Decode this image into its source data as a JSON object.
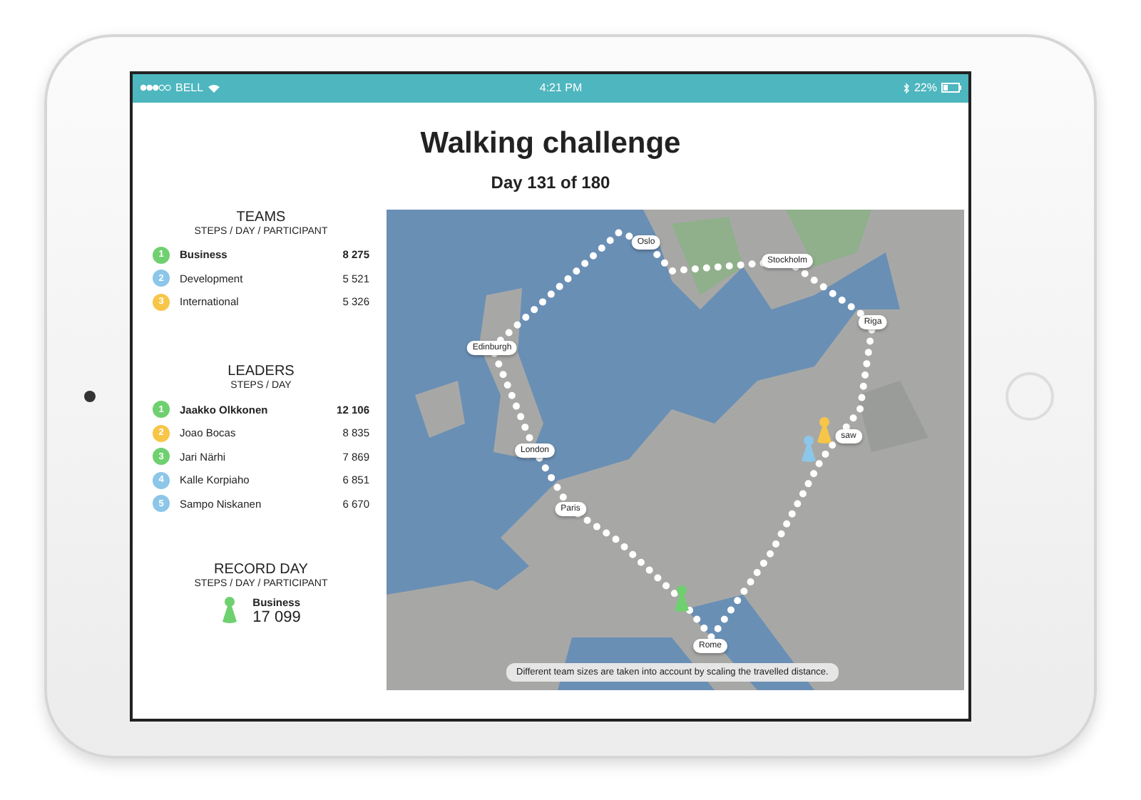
{
  "status_bar": {
    "carrier": "BELL",
    "time": "4:21 PM",
    "battery": "22%"
  },
  "title": "Walking challenge",
  "subtitle": "Day 131 of 180",
  "teams": {
    "title": "TEAMS",
    "subtitle": "STEPS / DAY / PARTICIPANT",
    "rows": [
      {
        "rank": "1",
        "name": "Business",
        "value": "8 275",
        "color": "#6fd06f",
        "highlighted": true
      },
      {
        "rank": "2",
        "name": "Development",
        "value": "5 521",
        "color": "#8cc6e8",
        "highlighted": false
      },
      {
        "rank": "3",
        "name": "International",
        "value": "5 326",
        "color": "#f7c548",
        "highlighted": false
      }
    ]
  },
  "leaders": {
    "title": "LEADERS",
    "subtitle": "STEPS / DAY",
    "rows": [
      {
        "rank": "1",
        "name": "Jaakko Olkkonen",
        "value": "12 106",
        "color": "#6fd06f",
        "highlighted": true
      },
      {
        "rank": "2",
        "name": "Joao Bocas",
        "value": "8 835",
        "color": "#f7c548",
        "highlighted": false
      },
      {
        "rank": "3",
        "name": "Jari Närhi",
        "value": "7 869",
        "color": "#6fd06f",
        "highlighted": false
      },
      {
        "rank": "4",
        "name": "Kalle Korpiaho",
        "value": "6 851",
        "color": "#8cc6e8",
        "highlighted": false
      },
      {
        "rank": "5",
        "name": "Sampo Niskanen",
        "value": "6 670",
        "color": "#8cc6e8",
        "highlighted": false
      }
    ]
  },
  "record_day": {
    "title": "RECORD DAY",
    "subtitle": "STEPS / DAY / PARTICIPANT",
    "team": "Business",
    "value": "17 099"
  },
  "map": {
    "cities": [
      "Oslo",
      "Stockholm",
      "Riga",
      "saw",
      "Edinburgh",
      "London",
      "Paris",
      "Rome"
    ],
    "pawns": [
      {
        "color": "#f7c548"
      },
      {
        "color": "#8cc6e8"
      },
      {
        "color": "#6fd06f"
      }
    ],
    "note": "Different team sizes are taken into account by scaling the travelled distance."
  }
}
